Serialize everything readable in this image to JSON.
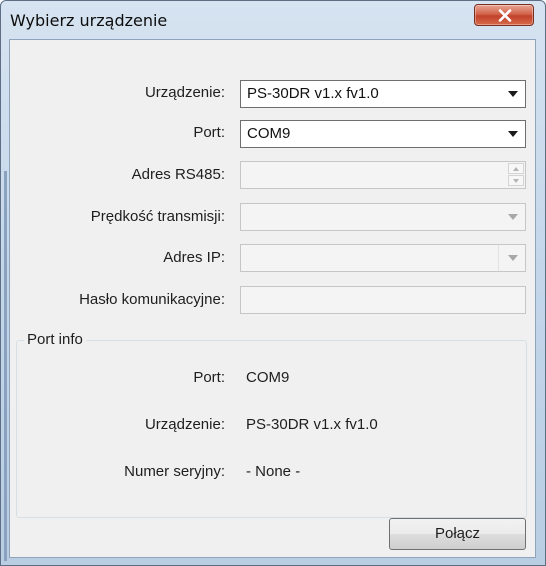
{
  "window": {
    "title": "Wybierz urządzenie",
    "close_icon": "close-icon"
  },
  "form": {
    "device": {
      "label": "Urządzenie:",
      "value": "PS-30DR v1.x fv1.0"
    },
    "port": {
      "label": "Port:",
      "value": "COM9"
    },
    "rs485": {
      "label": "Adres RS485:",
      "value": ""
    },
    "speed": {
      "label": "Prędkość transmisji:",
      "value": ""
    },
    "ip": {
      "label": "Adres IP:",
      "value": ""
    },
    "password": {
      "label": "Hasło komunikacyjne:",
      "value": ""
    }
  },
  "port_info": {
    "title": "Port info",
    "port_label": "Port:",
    "port_value": "COM9",
    "device_label": "Urządzenie:",
    "device_value": "PS-30DR v1.x fv1.0",
    "serial_label": "Numer seryjny:",
    "serial_value": "- None -"
  },
  "buttons": {
    "connect": "Połącz"
  },
  "colors": {
    "title_gradient": "#c3d6ea",
    "close_button": "#c2412a",
    "client_bg": "#f0f0f0"
  }
}
